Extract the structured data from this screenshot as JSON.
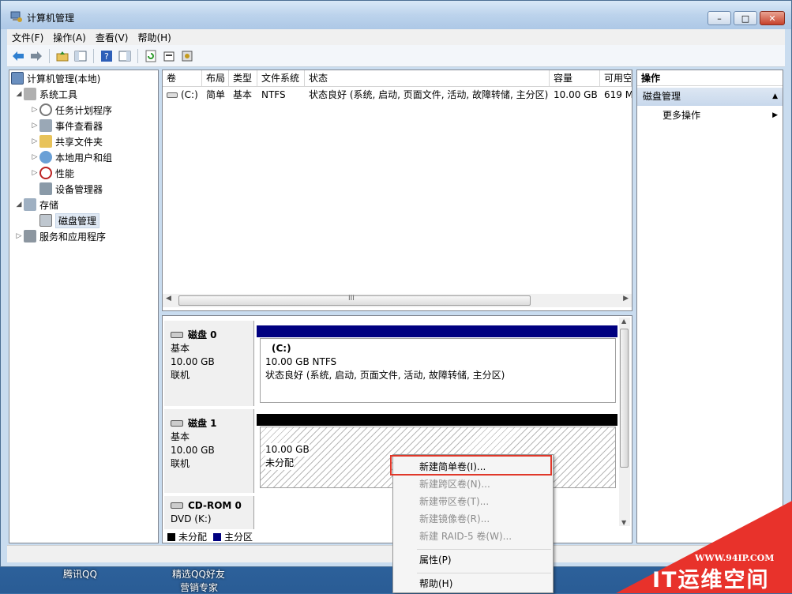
{
  "window": {
    "title": "计算机管理"
  },
  "menubar": [
    "文件(F)",
    "操作(A)",
    "查看(V)",
    "帮助(H)"
  ],
  "tree": {
    "root": "计算机管理(本地)",
    "system_tools": "系统工具",
    "task_scheduler": "任务计划程序",
    "event_viewer": "事件查看器",
    "shared_folders": "共享文件夹",
    "local_users": "本地用户和组",
    "performance": "性能",
    "device_manager": "设备管理器",
    "storage": "存储",
    "disk_management": "磁盘管理",
    "services_apps": "服务和应用程序"
  },
  "volume_list": {
    "headers": [
      "卷",
      "布局",
      "类型",
      "文件系统",
      "状态",
      "容量",
      "可用空"
    ],
    "rows": [
      {
        "volume": "(C:)",
        "layout": "简单",
        "type": "基本",
        "fs": "NTFS",
        "status": "状态良好 (系统, 启动, 页面文件, 活动, 故障转储, 主分区)",
        "capacity": "10.00 GB",
        "free": "619 M"
      }
    ],
    "scroll_grip": "III"
  },
  "disks": [
    {
      "name": "磁盘 0",
      "kind": "基本",
      "size": "10.00 GB",
      "state": "联机",
      "partition_name": "(C:)",
      "partition_size": "10.00 GB NTFS",
      "partition_status": "状态良好 (系统, 启动, 页面文件, 活动, 故障转储, 主分区)",
      "bar_color": "#000080"
    },
    {
      "name": "磁盘 1",
      "kind": "基本",
      "size": "10.00 GB",
      "state": "联机",
      "partition_size": "10.00 GB",
      "partition_status": "未分配",
      "bar_color": "#000000"
    },
    {
      "name": "CD-ROM 0",
      "kind": "DVD (K:)"
    }
  ],
  "legend": [
    {
      "label": "未分配",
      "color": "#000000"
    },
    {
      "label": "主分区",
      "color": "#000080"
    }
  ],
  "actions": {
    "header": "操作",
    "section": "磁盘管理",
    "more": "更多操作"
  },
  "context_menu": {
    "items": [
      {
        "label": "新建简单卷(I)...",
        "enabled": true
      },
      {
        "label": "新建跨区卷(N)...",
        "enabled": false
      },
      {
        "label": "新建带区卷(T)...",
        "enabled": false
      },
      {
        "label": "新建镜像卷(R)...",
        "enabled": false
      },
      {
        "label": "新建 RAID-5 卷(W)...",
        "enabled": false
      },
      {
        "label": "属性(P)",
        "enabled": true
      },
      {
        "label": "帮助(H)",
        "enabled": true
      }
    ]
  },
  "desktop": {
    "icon1": "腾讯QQ",
    "icon2a": "精选QQ好友",
    "icon2b": "营销专家"
  },
  "watermark": {
    "url": "WWW.94IP.COM",
    "brand": "IT运维空间"
  },
  "colors": {
    "highlight_border": "#e0382a",
    "primary_partition": "#000080"
  }
}
